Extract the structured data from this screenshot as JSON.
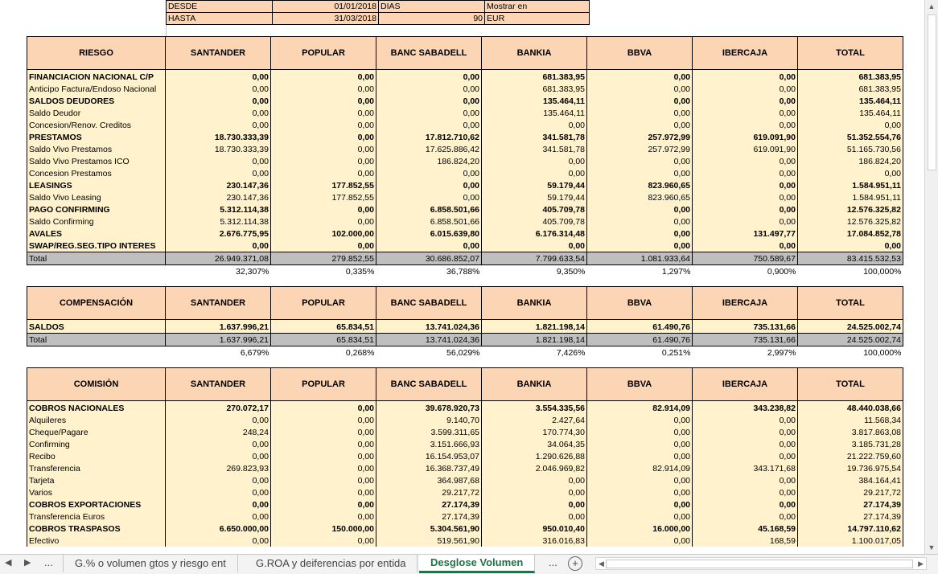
{
  "header": {
    "desde_label": "DESDE",
    "desde_value": "01/01/2018",
    "dias_label": "DIAS",
    "mostrar_label": "Mostrar en",
    "hasta_label": "HASTA",
    "hasta_value": "31/03/2018",
    "dias_value": "90",
    "mostrar_value": "EUR"
  },
  "riesgo": {
    "columns": [
      "RIESGO",
      "SANTANDER",
      "POPULAR",
      "BANC SABADELL",
      "BANKIA",
      "BBVA",
      "IBERCAJA",
      "TOTAL"
    ],
    "rows": [
      {
        "bold": true,
        "cells": [
          "FINANCIACION NACIONAL C/P",
          "0,00",
          "0,00",
          "0,00",
          "681.383,95",
          "0,00",
          "0,00",
          "681.383,95"
        ]
      },
      {
        "bold": false,
        "cells": [
          "Anticipo Factura/Endoso Nacional",
          "0,00",
          "0,00",
          "0,00",
          "681.383,95",
          "0,00",
          "0,00",
          "681.383,95"
        ]
      },
      {
        "bold": true,
        "cells": [
          "SALDOS DEUDORES",
          "0,00",
          "0,00",
          "0,00",
          "135.464,11",
          "0,00",
          "0,00",
          "135.464,11"
        ]
      },
      {
        "bold": false,
        "cells": [
          "Saldo Deudor",
          "0,00",
          "0,00",
          "0,00",
          "135.464,11",
          "0,00",
          "0,00",
          "135.464,11"
        ]
      },
      {
        "bold": false,
        "cells": [
          "Concesion/Renov. Creditos",
          "0,00",
          "0,00",
          "0,00",
          "0,00",
          "0,00",
          "0,00",
          "0,00"
        ]
      },
      {
        "bold": true,
        "cells": [
          "PRESTAMOS",
          "18.730.333,39",
          "0,00",
          "17.812.710,62",
          "341.581,78",
          "257.972,99",
          "619.091,90",
          "51.352.554,76"
        ]
      },
      {
        "bold": false,
        "cells": [
          "Saldo Vivo Prestamos",
          "18.730.333,39",
          "0,00",
          "17.625.886,42",
          "341.581,78",
          "257.972,99",
          "619.091,90",
          "51.165.730,56"
        ]
      },
      {
        "bold": false,
        "cells": [
          "Saldo Vivo Prestamos ICO",
          "0,00",
          "0,00",
          "186.824,20",
          "0,00",
          "0,00",
          "0,00",
          "186.824,20"
        ]
      },
      {
        "bold": false,
        "cells": [
          "Concesion Prestamos",
          "0,00",
          "0,00",
          "0,00",
          "0,00",
          "0,00",
          "0,00",
          "0,00"
        ]
      },
      {
        "bold": true,
        "cells": [
          "LEASINGS",
          "230.147,36",
          "177.852,55",
          "0,00",
          "59.179,44",
          "823.960,65",
          "0,00",
          "1.584.951,11"
        ]
      },
      {
        "bold": false,
        "cells": [
          "Saldo Vivo Leasing",
          "230.147,36",
          "177.852,55",
          "0,00",
          "59.179,44",
          "823.960,65",
          "0,00",
          "1.584.951,11"
        ]
      },
      {
        "bold": true,
        "cells": [
          "PAGO CONFIRMING",
          "5.312.114,38",
          "0,00",
          "6.858.501,66",
          "405.709,78",
          "0,00",
          "0,00",
          "12.576.325,82"
        ]
      },
      {
        "bold": false,
        "cells": [
          "Saldo Confirming",
          "5.312.114,38",
          "0,00",
          "6.858.501,66",
          "405.709,78",
          "0,00",
          "0,00",
          "12.576.325,82"
        ]
      },
      {
        "bold": true,
        "cells": [
          "AVALES",
          "2.676.775,95",
          "102.000,00",
          "6.015.639,80",
          "6.176.314,48",
          "0,00",
          "131.497,77",
          "17.084.852,78"
        ]
      },
      {
        "bold": true,
        "cells": [
          "SWAP/REG.SEG.TIPO INTERES",
          "0,00",
          "0,00",
          "0,00",
          "0,00",
          "0,00",
          "0,00",
          "0,00"
        ]
      }
    ],
    "total": [
      "Total",
      "26.949.371,08",
      "279.852,55",
      "30.686.852,07",
      "7.799.633,54",
      "1.081.933,64",
      "750.589,67",
      "83.415.532,53"
    ],
    "pct": [
      "",
      "32,307%",
      "0,335%",
      "36,788%",
      "9,350%",
      "1,297%",
      "0,900%",
      "100,000%"
    ]
  },
  "compensacion": {
    "columns": [
      "COMPENSACIÓN",
      "SANTANDER",
      "POPULAR",
      "BANC SABADELL",
      "BANKIA",
      "BBVA",
      "IBERCAJA",
      "TOTAL"
    ],
    "rows": [
      {
        "bold": true,
        "cells": [
          "SALDOS",
          "1.637.996,21",
          "65.834,51",
          "13.741.024,36",
          "1.821.198,14",
          "61.490,76",
          "735.131,66",
          "24.525.002,74"
        ]
      }
    ],
    "total": [
      "Total",
      "1.637.996,21",
      "65.834,51",
      "13.741.024,36",
      "1.821.198,14",
      "61.490,76",
      "735.131,66",
      "24.525.002,74"
    ],
    "pct": [
      "",
      "6,679%",
      "0,268%",
      "56,029%",
      "7,426%",
      "0,251%",
      "2,997%",
      "100,000%"
    ]
  },
  "comision": {
    "columns": [
      "COMISIÓN",
      "SANTANDER",
      "POPULAR",
      "BANC SABADELL",
      "BANKIA",
      "BBVA",
      "IBERCAJA",
      "TOTAL"
    ],
    "rows": [
      {
        "bold": true,
        "cells": [
          "COBROS NACIONALES",
          "270.072,17",
          "0,00",
          "39.678.920,73",
          "3.554.335,56",
          "82.914,09",
          "343.238,82",
          "48.440.038,66"
        ]
      },
      {
        "bold": false,
        "cells": [
          "Alquileres",
          "0,00",
          "0,00",
          "9.140,70",
          "2.427,64",
          "0,00",
          "0,00",
          "11.568,34"
        ]
      },
      {
        "bold": false,
        "cells": [
          "Cheque/Pagare",
          "248,24",
          "0,00",
          "3.599.311,65",
          "170.774,30",
          "0,00",
          "0,00",
          "3.817.863,08"
        ]
      },
      {
        "bold": false,
        "cells": [
          "Confirming",
          "0,00",
          "0,00",
          "3.151.666,93",
          "34.064,35",
          "0,00",
          "0,00",
          "3.185.731,28"
        ]
      },
      {
        "bold": false,
        "cells": [
          "Recibo",
          "0,00",
          "0,00",
          "16.154.953,07",
          "1.290.626,88",
          "0,00",
          "0,00",
          "21.222.759,60"
        ]
      },
      {
        "bold": false,
        "cells": [
          "Transferencia",
          "269.823,93",
          "0,00",
          "16.368.737,49",
          "2.046.969,82",
          "82.914,09",
          "343.171,68",
          "19.736.975,54"
        ]
      },
      {
        "bold": false,
        "cells": [
          "Tarjeta",
          "0,00",
          "0,00",
          "364.987,68",
          "0,00",
          "0,00",
          "0,00",
          "384.164,41"
        ]
      },
      {
        "bold": false,
        "cells": [
          "Varios",
          "0,00",
          "0,00",
          "29.217,72",
          "0,00",
          "0,00",
          "0,00",
          "29.217,72"
        ]
      },
      {
        "bold": true,
        "cells": [
          "COBROS EXPORTACIONES",
          "0,00",
          "0,00",
          "27.174,39",
          "0,00",
          "0,00",
          "0,00",
          "27.174,39"
        ]
      },
      {
        "bold": false,
        "cells": [
          "Transferencia Euros",
          "0,00",
          "0,00",
          "27.174,39",
          "0,00",
          "0,00",
          "0,00",
          "27.174,39"
        ]
      },
      {
        "bold": true,
        "cells": [
          "COBROS TRASPASOS",
          "6.650.000,00",
          "150.000,00",
          "5.304.561,90",
          "950.010,40",
          "16.000,00",
          "45.168,59",
          "14.797.110,62"
        ]
      },
      {
        "bold": false,
        "cells": [
          "Efectivo",
          "0,00",
          "0,00",
          "519.561,90",
          "316.016,83",
          "0,00",
          "168,59",
          "1.100.017,05"
        ]
      }
    ]
  },
  "tabs": {
    "ellipsis_left": "...",
    "tab1": "G.% o volumen gtos y riesgo ent",
    "tab2": "G.ROA y deiferencias por entida",
    "tab3": "Desglose Volumen",
    "ellipsis_right": "..."
  }
}
